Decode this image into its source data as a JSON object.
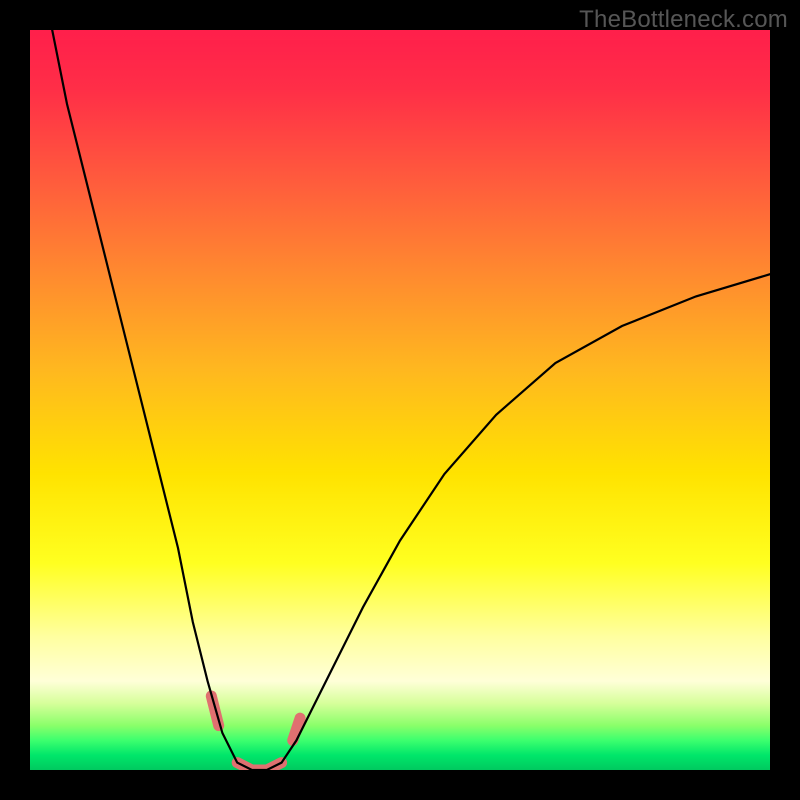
{
  "watermark": "TheBottleneck.com",
  "colors": {
    "frame_bg": "#000000",
    "curve_stroke": "#000000",
    "marker_stroke": "#e07070",
    "gradient_top": "#ff1f4b",
    "gradient_bottom": "#00c95f"
  },
  "chart_data": {
    "type": "line",
    "title": "",
    "xlabel": "",
    "ylabel": "",
    "xlim": [
      0,
      100
    ],
    "ylim": [
      0,
      100
    ],
    "grid": false,
    "legend": false,
    "description": "V-shaped bottleneck curve. Curve value is % mismatch (high = red = bad, near 0 = green = good). Two steep arms descend from the top edge toward a narrow flat trough near x≈26–34, y≈0–2, then rise again; right arm exits the right edge around y≈67.",
    "series": [
      {
        "name": "bottleneck-curve",
        "x": [
          3,
          5,
          8,
          11,
          14,
          17,
          20,
          22,
          24,
          26,
          28,
          30,
          32,
          34,
          36,
          38,
          41,
          45,
          50,
          56,
          63,
          71,
          80,
          90,
          100
        ],
        "y": [
          100,
          90,
          78,
          66,
          54,
          42,
          30,
          20,
          12,
          5,
          1,
          0,
          0,
          1,
          4,
          8,
          14,
          22,
          31,
          40,
          48,
          55,
          60,
          64,
          67
        ]
      }
    ],
    "markers": {
      "description": "Short coral segments on the curve flanking the trough (highlight zone)",
      "points": [
        {
          "x": 24.5,
          "y": 10
        },
        {
          "x": 25.5,
          "y": 6
        },
        {
          "x": 28,
          "y": 1
        },
        {
          "x": 30,
          "y": 0
        },
        {
          "x": 32,
          "y": 0
        },
        {
          "x": 34,
          "y": 1
        },
        {
          "x": 35.5,
          "y": 4
        },
        {
          "x": 36.5,
          "y": 7
        }
      ]
    }
  }
}
